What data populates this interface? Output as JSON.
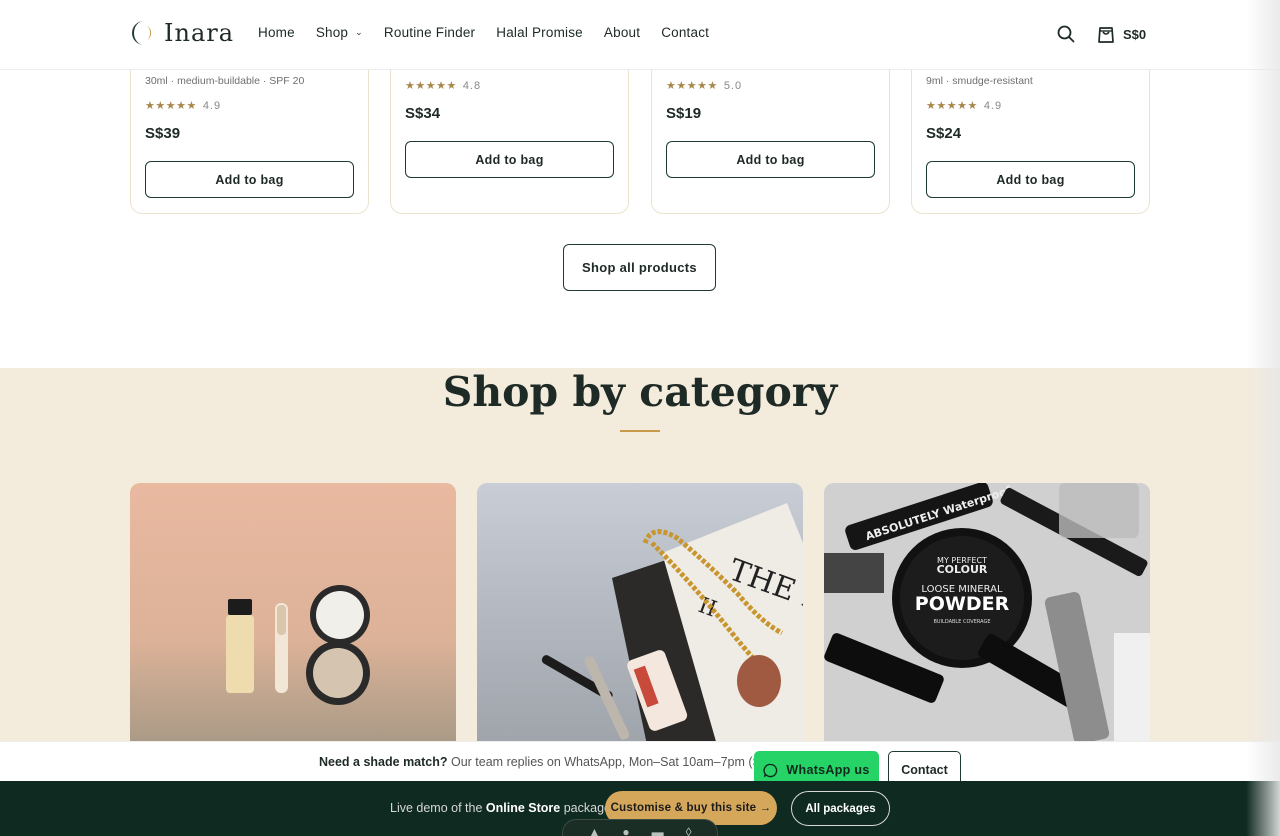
{
  "header": {
    "brand": "Inara",
    "nav": [
      "Home",
      "Shop",
      "Routine Finder",
      "Halal Promise",
      "About",
      "Contact"
    ],
    "cart_total": "S$0",
    "icons": {
      "search": "search-icon",
      "cart": "shopping-bag-icon",
      "shop_dropdown": "chevron-down-icon"
    }
  },
  "products": [
    {
      "meta": "30ml · medium-buildable · SPF 20",
      "stars": "★★★★★",
      "rating": "4.9",
      "price": "S$39",
      "button": "Add to bag"
    },
    {
      "meta": "",
      "stars": "★★★★★",
      "rating": "4.8",
      "price": "S$34",
      "button": "Add to bag"
    },
    {
      "meta": "",
      "stars": "★★★★★",
      "rating": "5.0",
      "price": "S$19",
      "button": "Add to bag"
    },
    {
      "meta": "9ml · smudge-resistant",
      "stars": "★★★★★",
      "rating": "4.9",
      "price": "S$24",
      "button": "Add to bag"
    }
  ],
  "shop_all_label": "Shop all products",
  "category": {
    "title": "Shop by category",
    "tiles": [
      "complexion-products-photo",
      "lips-accessories-photo",
      "mineral-powder-photo"
    ]
  },
  "help_bar": {
    "lead": "Need a shade match?",
    "text": "Our team replies on WhatsApp, Mon–Sat 10am–7pm (SGT).",
    "whatsapp_label": "WhatsApp us",
    "contact_label": "Contact"
  },
  "demo_bar": {
    "prefix": "Live demo of the",
    "package": "Online Store",
    "suffix": "package.",
    "customise_label": "Customise & buy this site →",
    "packages_label": "All packages"
  },
  "colors": {
    "brand_dark": "#0f2a20",
    "accent_gold": "#c79a4c",
    "cream": "#f3ebdc",
    "whatsapp": "#25d366"
  }
}
